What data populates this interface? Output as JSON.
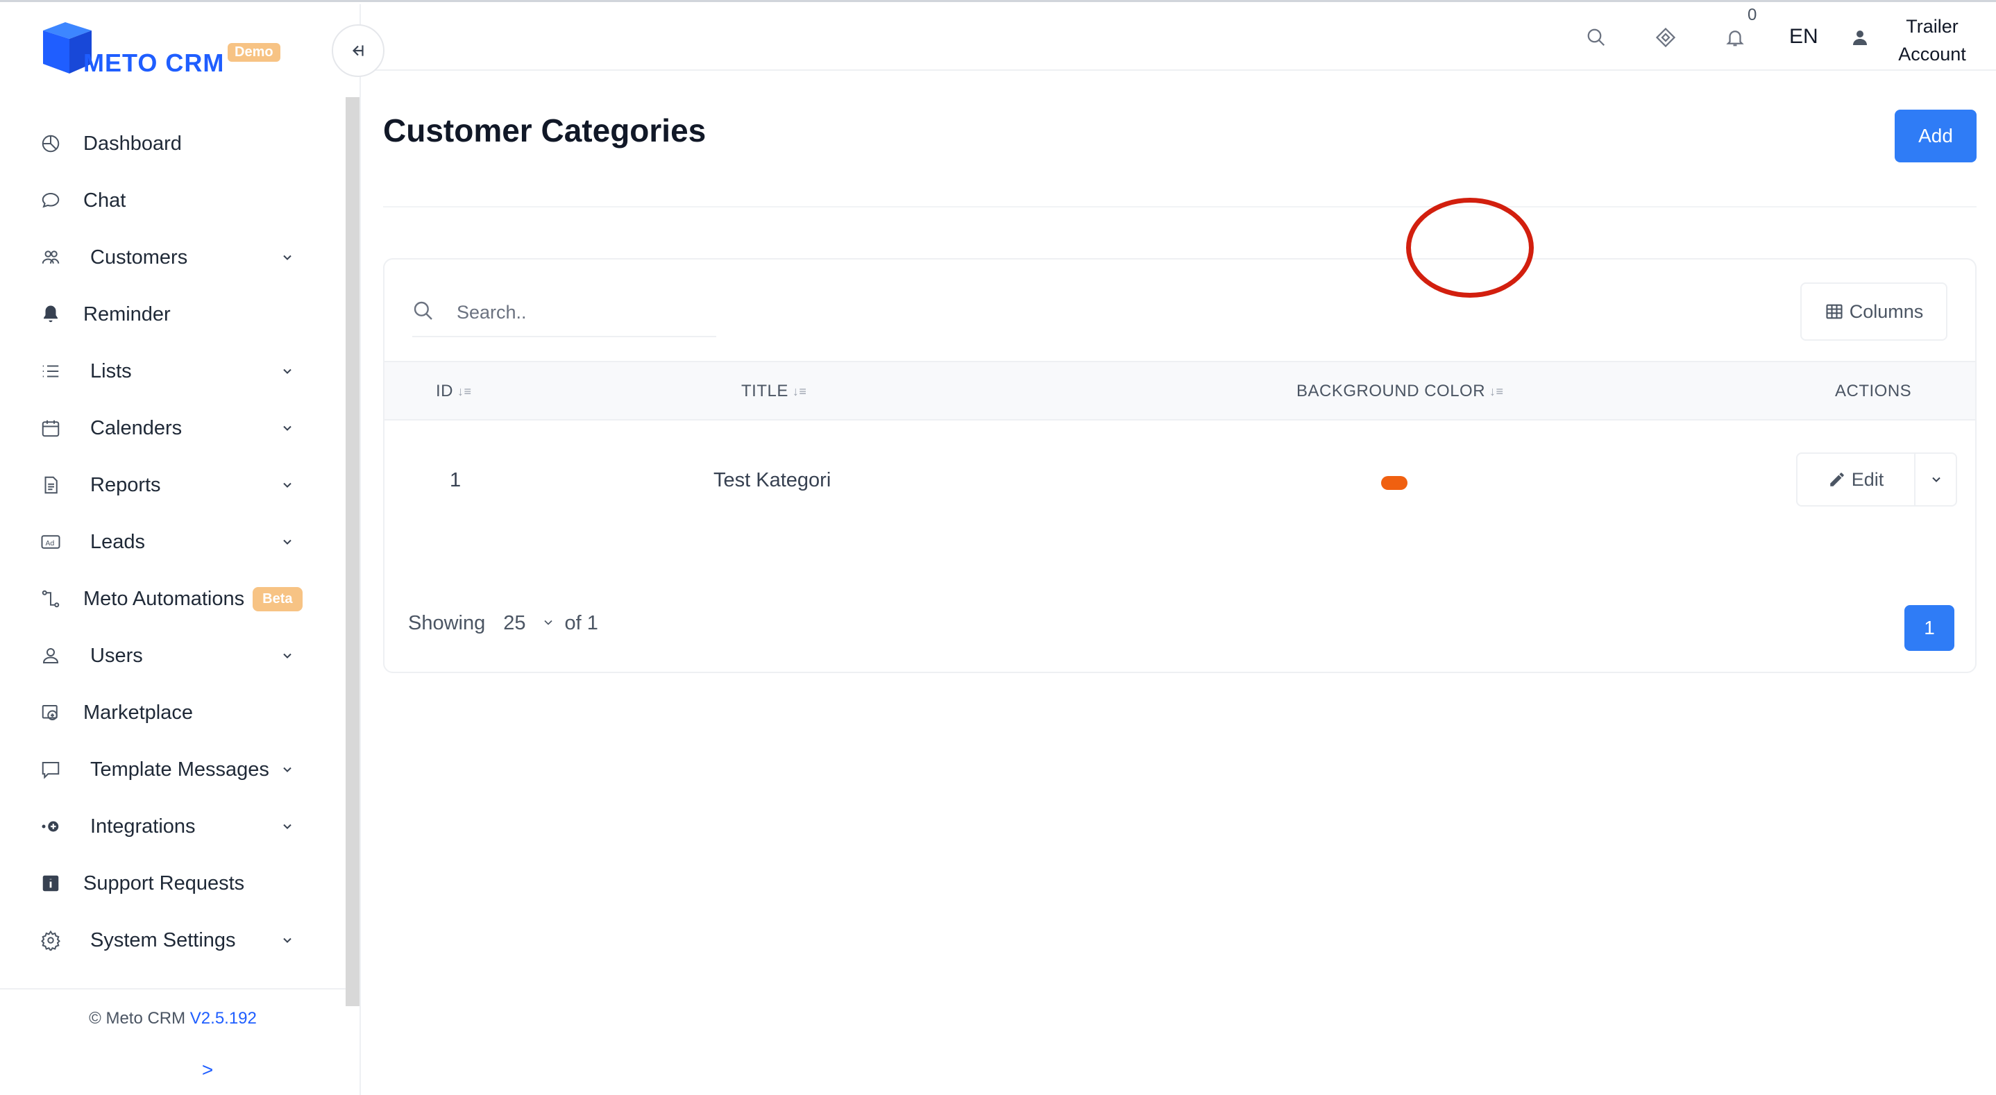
{
  "app": {
    "logo_text": "METO CRM",
    "logo_badge": "Demo",
    "brand_color": "#1f5eff",
    "version_prefix": "© Meto CRM",
    "version": "V2.5.192",
    "expand_glyph": ">"
  },
  "sidebar": {
    "items": [
      {
        "label": "Dashboard",
        "icon": "dashboard-icon",
        "has_sub": false
      },
      {
        "label": "Chat",
        "icon": "chat-icon",
        "has_sub": false
      },
      {
        "label": "Customers",
        "icon": "customers-icon",
        "has_sub": true
      },
      {
        "label": "Reminder",
        "icon": "bell-icon",
        "has_sub": false
      },
      {
        "label": "Lists",
        "icon": "list-icon",
        "has_sub": true
      },
      {
        "label": "Calenders",
        "icon": "calendar-icon",
        "has_sub": true
      },
      {
        "label": "Reports",
        "icon": "report-icon",
        "has_sub": true
      },
      {
        "label": "Leads",
        "icon": "ad-icon",
        "has_sub": true
      },
      {
        "label": "Meto Automations",
        "icon": "automation-icon",
        "has_sub": false,
        "badge": "Beta"
      },
      {
        "label": "Users",
        "icon": "user-icon",
        "has_sub": true
      },
      {
        "label": "Marketplace",
        "icon": "marketplace-icon",
        "has_sub": false
      },
      {
        "label": "Template Messages",
        "icon": "template-icon",
        "has_sub": true
      },
      {
        "label": "Integrations",
        "icon": "integration-icon",
        "has_sub": true
      },
      {
        "label": "Support Requests",
        "icon": "info-icon",
        "has_sub": false
      },
      {
        "label": "System Settings",
        "icon": "gear-icon",
        "has_sub": true
      }
    ]
  },
  "topbar": {
    "notification_count": "0",
    "language": "EN",
    "user_line1": "Trailer",
    "user_line2": "Account"
  },
  "page": {
    "title": "Customer Categories",
    "add_label": "Add"
  },
  "table": {
    "search_placeholder": "Search..",
    "columns_label": "Columns",
    "headers": {
      "id": "ID",
      "title": "TITLE",
      "background_color": "BACKGROUND COLOR",
      "actions": "ACTIONS"
    },
    "rows": [
      {
        "id": "1",
        "title": "Test Kategori",
        "background_color": "#f06010",
        "edit_label": "Edit"
      }
    ],
    "footer": {
      "showing_label": "Showing",
      "page_size": "25",
      "of_label": "of 1",
      "current_page": "1"
    }
  },
  "colors": {
    "primary": "#2f7cf6",
    "highlight_circle": "#d21f0e",
    "badge": "#f7c384"
  }
}
